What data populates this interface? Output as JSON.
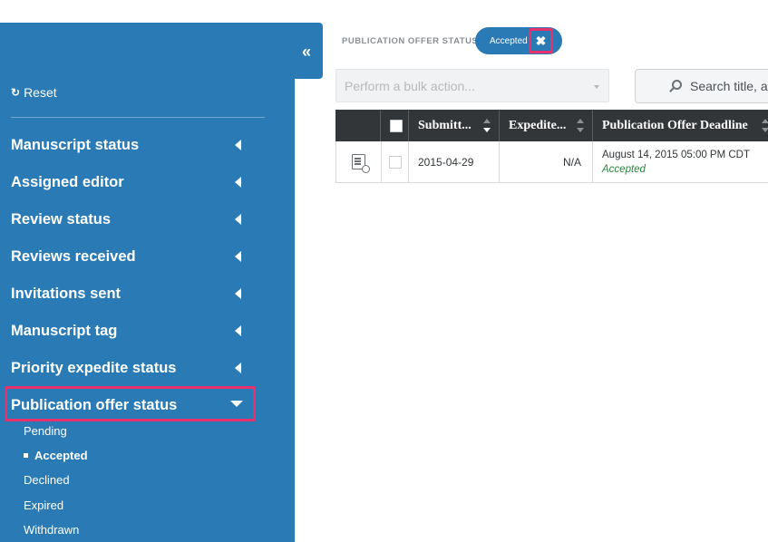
{
  "sidebar": {
    "collapse_label": "«",
    "reset_label": "Reset",
    "filters": [
      {
        "label": "Manuscript status"
      },
      {
        "label": "Assigned editor"
      },
      {
        "label": "Review status"
      },
      {
        "label": "Reviews received"
      },
      {
        "label": "Invitations sent"
      },
      {
        "label": "Manuscript tag"
      },
      {
        "label": "Priority expedite status"
      },
      {
        "label": "Publication offer status"
      }
    ],
    "open_filter_options": [
      {
        "label": "Pending",
        "selected": false
      },
      {
        "label": "Accepted",
        "selected": true
      },
      {
        "label": "Declined",
        "selected": false
      },
      {
        "label": "Expired",
        "selected": false
      },
      {
        "label": "Withdrawn",
        "selected": false
      }
    ]
  },
  "active_filter": {
    "label": "PUBLICATION OFFER STATUS",
    "value": "Accepted",
    "remove_icon": "close-icon"
  },
  "toolbar": {
    "bulk_placeholder": "Perform a bulk action...",
    "search_text": "Search title, au"
  },
  "table": {
    "columns": [
      "Submitt...",
      "Expedite...",
      "Publication Offer Deadline"
    ],
    "rows": [
      {
        "submitted": "2015-04-29",
        "expedite": "N/A",
        "deadline": "August 14, 2015 05:00 PM CDT",
        "status": "Accepted"
      }
    ]
  },
  "colors": {
    "sidebar": "#2a7ab5",
    "highlight": "#e8316a",
    "accepted": "#2e8540",
    "table_header": "#333638"
  }
}
